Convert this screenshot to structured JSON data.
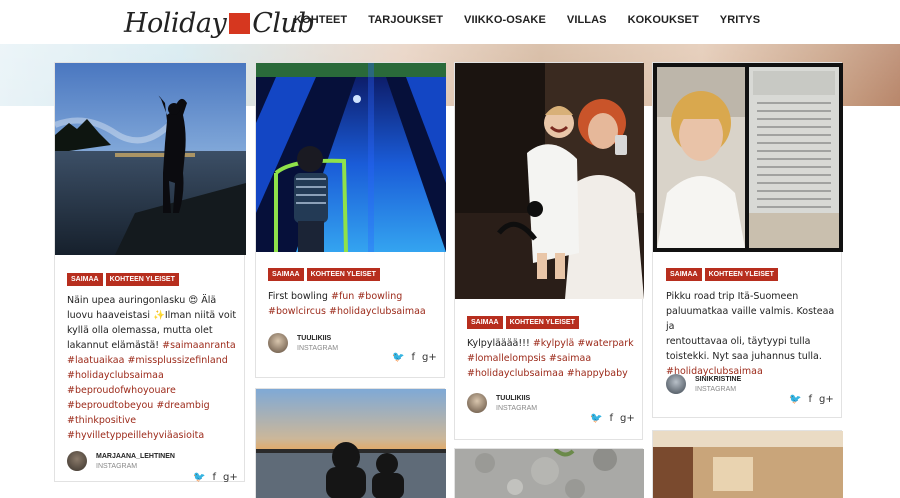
{
  "header": {
    "logo_left": "Holiday",
    "logo_right": "Club",
    "nav": [
      "KOHTEET",
      "TARJOUKSET",
      "VIIKKO-OSAKE",
      "VILLAS",
      "KOKOUKSET",
      "YRITYS"
    ]
  },
  "colors": {
    "accent": "#b72e1e",
    "logo_box": "#d6371f",
    "hashtag": "#9c2a1a"
  },
  "cards": [
    {
      "tags": [
        "SAIMAA",
        "KOHTEEN YLEISET"
      ],
      "caption_plain": "Näin upea auringonlasku 😍 Älä luovu haaveistasi ✨Ilman niitä voit kyllä olla olemassa, mutta olet lakannut elämästä!",
      "caption_lines": [
        "Näin upea auringonlasku 😍 Älä",
        "luovu haaveistasi ✨Ilman niitä voit",
        "kyllä olla olemassa, mutta olet",
        "lakannut elämästä! #saimaanranta",
        "#laatuaikaa #missplussizefinland",
        "#holidayclubsaimaa",
        "#beproudofwhoyouare",
        "#beproudtobeyou #dreambig",
        "#thinkpositive",
        "#hyvilletyppeillehyviäasioita"
      ],
      "author": "MARJAANA_LEHTINEN",
      "source": "INSTAGRAM"
    },
    {
      "tags": [
        "SAIMAA",
        "KOHTEEN YLEISET"
      ],
      "caption_lines": [
        "First bowling #fun #bowling",
        "#bowlcircus #holidayclubsaimaa"
      ],
      "author": "TUULIKIIS",
      "source": "INSTAGRAM"
    },
    {
      "tags": [
        "SAIMAA",
        "KOHTEEN YLEISET"
      ],
      "caption_lines": [
        "Kylpylääää!!! #kylpylä #waterpark",
        "#lomallelompsis #saimaa",
        "#holidayclubsaimaa #happybaby"
      ],
      "author": "TUULIKIIS",
      "source": "INSTAGRAM"
    },
    {
      "tags": [
        "SAIMAA",
        "KOHTEEN YLEISET"
      ],
      "caption_lines": [
        "Pikku road trip Itä-Suomeen",
        "paluumatkaa vaille valmis. Kosteaa ja",
        "rentouttavaa oli, täytyypi tulla",
        "toistekki. Nyt saa juhannus tulla.",
        "#holidayclubsaimaa"
      ],
      "author": "SINIKRISTINE",
      "source": "INSTAGRAM"
    }
  ],
  "share": {
    "twitter": "🐦",
    "facebook": "f",
    "gplus": "g+"
  }
}
